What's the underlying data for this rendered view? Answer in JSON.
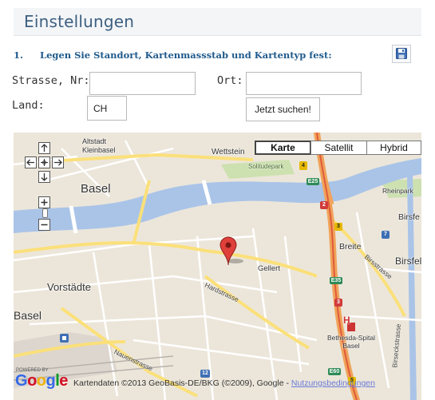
{
  "header": {
    "title": "Einstellungen"
  },
  "step": {
    "number": "1.",
    "text": "Legen Sie Standort, Kartenmassstab und Kartentyp fest:",
    "save_icon": "floppy-disk-icon"
  },
  "form": {
    "street_label": "Strasse, Nr:",
    "street_value": "",
    "city_label": "Ort:",
    "city_value": "",
    "country_label": "Land:",
    "country_value": "CH",
    "search_button": "Jetzt suchen!"
  },
  "map": {
    "map_types": [
      "Karte",
      "Satellit",
      "Hybrid"
    ],
    "active_map_type": "Karte",
    "nav_icons": [
      "pan-up-icon",
      "pan-left-icon",
      "pan-center-icon",
      "pan-right-icon",
      "pan-down-icon",
      "zoom-in-icon",
      "zoom-out-icon"
    ],
    "places": {
      "altstadt": "Altstadt\nKleinbasel",
      "basel_center": "Basel",
      "wettstein": "Wettstein",
      "solitudepark": "Solitudepark",
      "rheinpark": "Rheinpark",
      "birsfelden_cut": "Birsfe",
      "breite": "Breite",
      "birsfelden2_cut": "Birsfel",
      "gellert": "Gellert",
      "vorstaedte": "Vorstädte",
      "basel_left": "Basel",
      "hospital": "Bethesda-Spital\nBasel",
      "hospital_marker": "H"
    },
    "streets": {
      "hardstrasse": "Hardstrasse",
      "birsstrasse": "Birsstrasse",
      "nauenstrasse": "Nauenstrasse",
      "birseckstrasse": "Birseckstrasse"
    },
    "shields": {
      "r4": "4",
      "e25": "E25",
      "r2": "2",
      "r3": "3",
      "r7": "7",
      "e35": "E35",
      "r3b": "3",
      "r12": "12",
      "e60": "E60",
      "r5": "5"
    },
    "attribution": {
      "powered_by": "POWERED BY",
      "logo": "Google",
      "copyright": "Kartendaten ©2013 GeoBasis-DE/BKG (©2009), Google - ",
      "terms_link": "Nutzungsbedingungen"
    },
    "marker_icon": "map-pin-icon",
    "colors": {
      "water": "#aac4e8",
      "highway": "#f0a35a",
      "main_road": "#fbe07a",
      "land": "#ece6da",
      "park": "#cde0b0"
    }
  }
}
